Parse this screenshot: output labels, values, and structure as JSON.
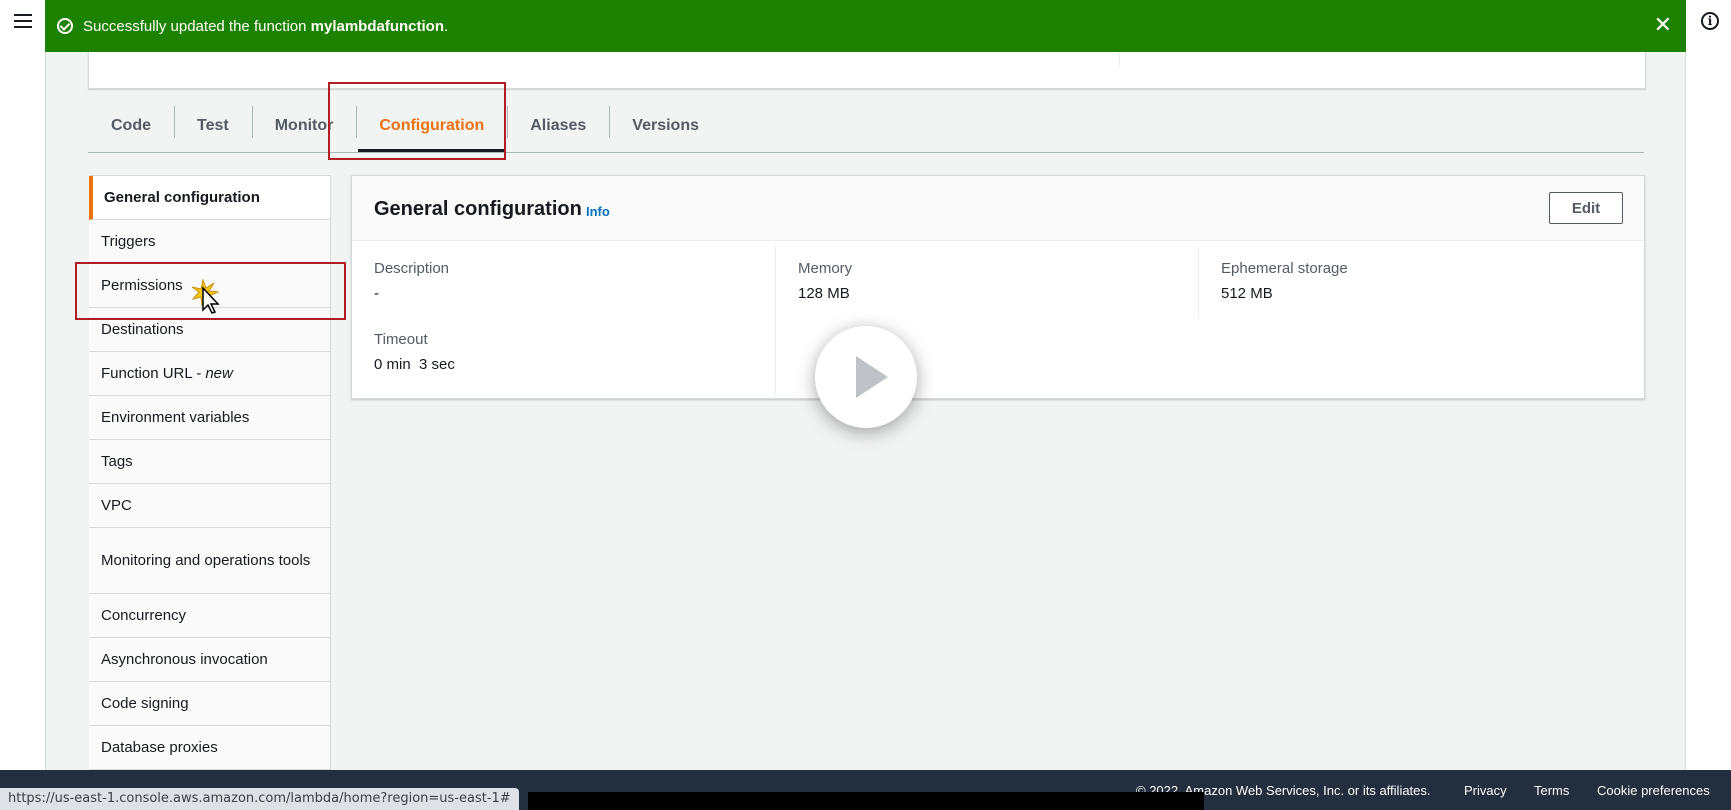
{
  "flash": {
    "message_prefix": "Successfully updated the function",
    "function_name": "mylambdafunction",
    "message_suffix": ".",
    "color": "#1d8102"
  },
  "tabs": [
    {
      "label": "Code"
    },
    {
      "label": "Test"
    },
    {
      "label": "Monitor"
    },
    {
      "label": "Configuration",
      "active": true
    },
    {
      "label": "Aliases"
    },
    {
      "label": "Versions"
    }
  ],
  "side_nav": {
    "items": [
      {
        "label": "General configuration",
        "active": true
      },
      {
        "label": "Triggers"
      },
      {
        "label": "Permissions"
      },
      {
        "label": "Destinations"
      },
      {
        "label": "Function URL -",
        "suffix": "new"
      },
      {
        "label": "Environment variables"
      },
      {
        "label": "Tags"
      },
      {
        "label": "VPC"
      },
      {
        "label": "Monitoring and operations tools"
      },
      {
        "label": "Concurrency"
      },
      {
        "label": "Asynchronous invocation"
      },
      {
        "label": "Code signing"
      },
      {
        "label": "Database proxies"
      }
    ]
  },
  "panel": {
    "title": "General configuration",
    "info": "Info",
    "edit_label": "Edit",
    "fields": {
      "description": {
        "label": "Description",
        "value": "-"
      },
      "memory": {
        "label": "Memory",
        "value": "128 MB"
      },
      "ephemeral": {
        "label": "Ephemeral storage",
        "value": "512 MB"
      },
      "timeout": {
        "label": "Timeout",
        "value": "0 min  3 sec"
      }
    }
  },
  "footer": {
    "copyright": "© 2022. Amazon Web Services, Inc. or its affiliates.",
    "privacy": "Privacy",
    "terms": "Terms",
    "cookie": "Cookie preferences"
  },
  "status_url": "https://us-east-1.console.aws.amazon.com/lambda/home?region=us-east-1#",
  "colors": {
    "accent": "#ec7211",
    "link": "#0073bb",
    "highlight": "#b01e23",
    "footer_bg": "#232f3e"
  }
}
